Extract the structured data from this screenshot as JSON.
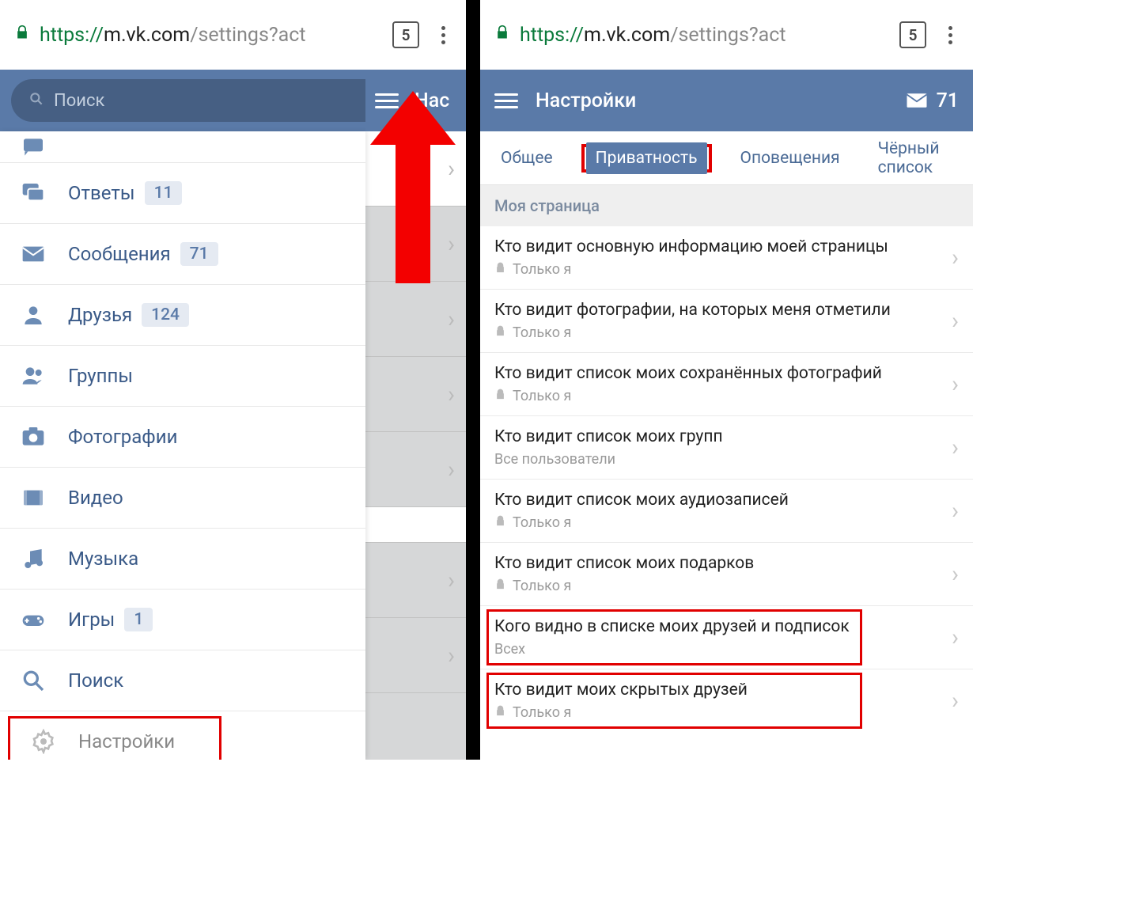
{
  "browser": {
    "url_scheme": "https://",
    "url_domain": "m.vk.com",
    "url_path": "/settings?act",
    "tab_count": "5"
  },
  "left": {
    "search_placeholder": "Поиск",
    "header_title_partial": "Нас",
    "menu": [
      {
        "label": "Ответы",
        "badge": "11",
        "icon": "replies"
      },
      {
        "label": "Сообщения",
        "badge": "71",
        "icon": "envelope"
      },
      {
        "label": "Друзья",
        "badge": "124",
        "icon": "person"
      },
      {
        "label": "Группы",
        "badge": "",
        "icon": "people"
      },
      {
        "label": "Фотографии",
        "badge": "",
        "icon": "camera"
      },
      {
        "label": "Видео",
        "badge": "",
        "icon": "film"
      },
      {
        "label": "Музыка",
        "badge": "",
        "icon": "music"
      },
      {
        "label": "Игры",
        "badge": "1",
        "icon": "gamepad"
      },
      {
        "label": "Поиск",
        "badge": "",
        "icon": "search"
      },
      {
        "label": "Настройки",
        "badge": "",
        "icon": "gear"
      }
    ]
  },
  "right": {
    "header_title": "Настройки",
    "messages_count": "71",
    "tabs": {
      "general": "Общее",
      "privacy": "Приватность",
      "notifications": "Оповещения",
      "blacklist": "Чёрный список"
    },
    "section_title": "Моя страница",
    "value_only_me": "Только я",
    "value_all_users": "Все пользователи",
    "value_everyone": "Всех",
    "rows": {
      "r0": "Кто видит основную информацию моей страницы",
      "r1": "Кто видит фотографии, на которых меня отметили",
      "r2": "Кто видит список моих сохранённых фотографий",
      "r3": "Кто видит список моих групп",
      "r4": "Кто видит список моих аудиозаписей",
      "r5": "Кто видит список моих подарков",
      "r6": "Кого видно в списке моих друзей и подписок",
      "r7": "Кто видит моих скрытых друзей"
    }
  }
}
